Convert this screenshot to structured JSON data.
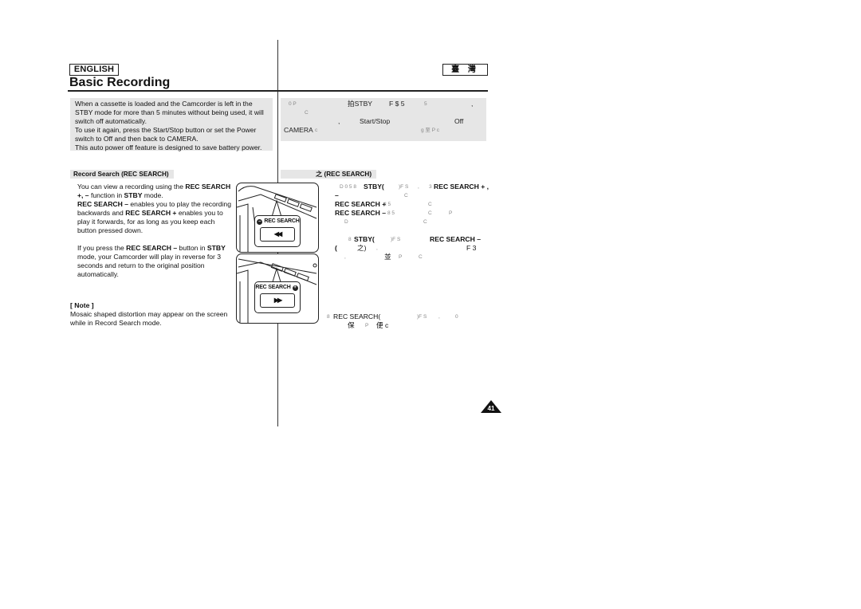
{
  "header": {
    "language_label": "ENGLISH",
    "language_label_zh": "臺 灣",
    "title": "Basic Recording"
  },
  "intro": {
    "en": [
      "When a cassette is loaded and the Camcorder is left in the STBY mode for more than 5 minutes without being used, it will switch off automatically.",
      "To use it again, press the Start/Stop button or set the Power switch to Off and then back to CAMERA.",
      "This auto power off feature is designed to save battery power."
    ],
    "zh_fragments": {
      "line1": [
        "0 P",
        "拍STBY",
        "F $ 5",
        "5",
        ","
      ],
      "line2": [
        "C"
      ],
      "line3": [
        ",",
        "Start/Stop",
        "Off"
      ],
      "line4": [
        "CAMERA",
        "c",
        "g 至 P c"
      ]
    }
  },
  "section": {
    "heading": "Record Search (REC SEARCH)",
    "heading_zh": "之 (REC SEARCH)",
    "para1": {
      "t1": "You can view a recording using the ",
      "b1": "REC SEARCH +, –",
      "t2": " function in ",
      "b2": "STBY",
      "t3": " mode.",
      "b3": "REC SEARCH –",
      "t4": " enables you to play the recording backwards and ",
      "b4": "REC SEARCH +",
      "t5": " enables you to play it forwards, for as long as you keep each button pressed down."
    },
    "para2": {
      "t1": "If you press the ",
      "b1": "REC SEARCH –",
      "t2": " button in ",
      "b2": "STBY",
      "t3": " mode, your Camcorder will play in reverse for 3 seconds and return to the original position automatically."
    },
    "note": {
      "title": "[ Note ]",
      "text": "Mosaic shaped distortion may appear on the screen while in Record Search mode."
    }
  },
  "zh_body": {
    "l1a": "D 0 5 8",
    "l1b": "STBY(",
    "l1c": ")F S",
    "l1d": ",",
    "l1e": "3",
    "l1f": "REC SEARCH + ,",
    "l2a": "–",
    "l2b": "C",
    "l3a": "REC SEARCH +",
    "l3b": "‖ 5",
    "l3c": "C",
    "l4a": "REC SEARCH –",
    "l4b": "8 5",
    "l4c": "C",
    "l4d": "P",
    "l5a": "D",
    "l5b": "C",
    "l6a": "8",
    "l6b": "STBY(",
    "l6c": ")F S",
    "l6d": "REC SEARCH –",
    "l7a": "(",
    "l7b": "之)",
    "l7c": ",",
    "l7d": "F 3",
    "l8a": ",",
    "l8b": "並",
    "l8c": "P",
    "l8d": "C",
    "note_l1a": "8",
    "note_l1b": "REC SEARCH(",
    "note_l1c": ")F S",
    "note_l1d": ",",
    "note_l1e": "0",
    "note_l2a": "保",
    "note_l2b": "P",
    "note_l2c": "便 c"
  },
  "illustrations": {
    "top": {
      "label": "REC SEARCH",
      "sign": "–",
      "button_glyph": "◀◀"
    },
    "bottom": {
      "label": "REC SEARCH",
      "sign": "+",
      "button_glyph": "▶▶"
    }
  },
  "page_number": "41"
}
